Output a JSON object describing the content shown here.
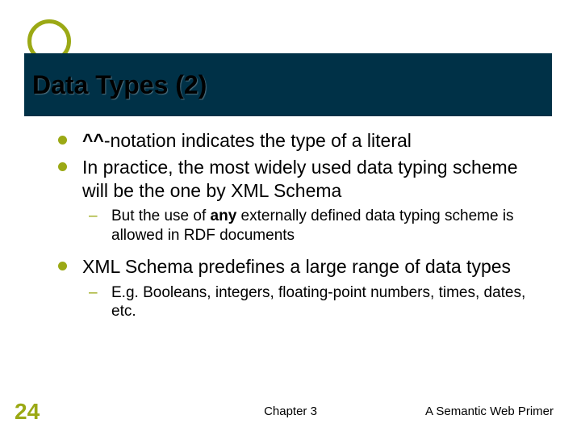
{
  "accent_color": "#9BA915",
  "dark_color": "#003147",
  "title": "Data Types (2)",
  "bullets": [
    {
      "prefix_bold": "^^",
      "rest": "-notation indicates the type of a literal"
    },
    {
      "text": "In practice, the most widely used data typing scheme will be the one by XML Schema",
      "sub": [
        {
          "pre": "But the use of ",
          "bold": "any",
          "post": " externally defined data typing scheme is allowed in RDF documents"
        }
      ]
    },
    {
      "text": "XML Schema predefines a large range of data types",
      "sub": [
        {
          "text": "E.g. Booleans, integers, floating-point numbers, times, dates, etc."
        }
      ]
    }
  ],
  "page_number": "24",
  "footer_center": "Chapter 3",
  "footer_right": "A Semantic Web Primer"
}
